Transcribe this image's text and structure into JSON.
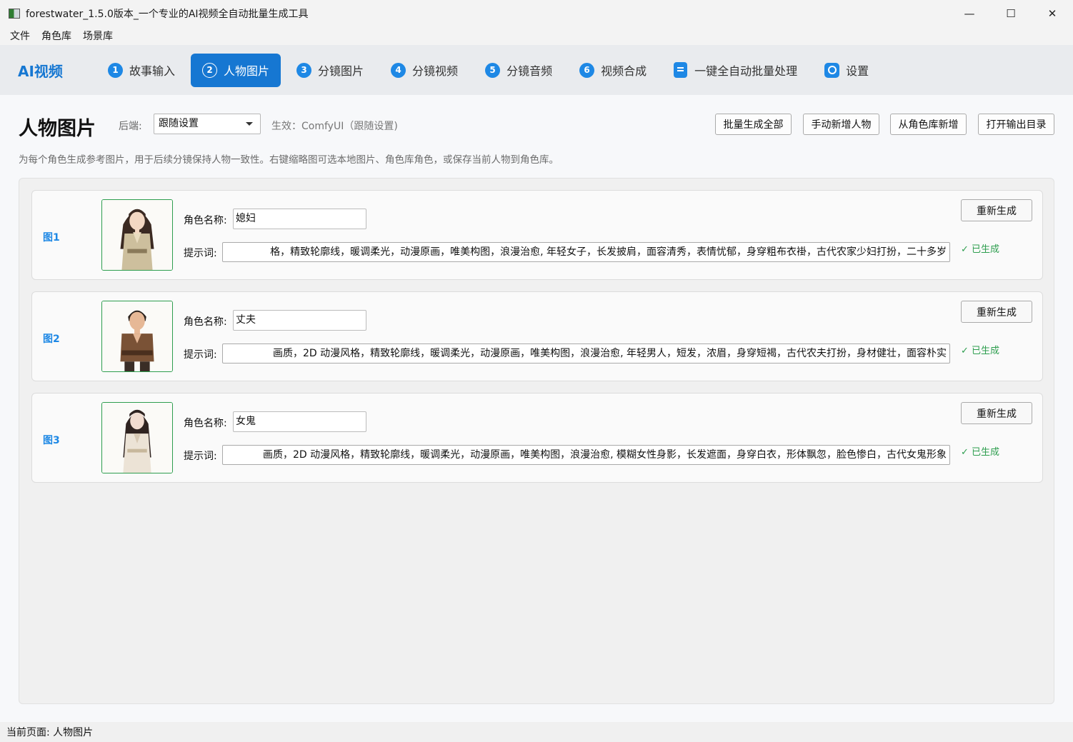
{
  "window": {
    "title": "forestwater_1.5.0版本_一个专业的AI视频全自动批量生成工具",
    "controls": {
      "minimize": "—",
      "maximize": "☐",
      "close": "✕"
    }
  },
  "menu": [
    "文件",
    "角色库",
    "场景库"
  ],
  "nav": {
    "brand": "AI视频",
    "tabs": [
      {
        "num": "1",
        "label": "故事输入",
        "icon": "number-badge"
      },
      {
        "num": "2",
        "label": "人物图片",
        "icon": "number-badge",
        "active": true
      },
      {
        "num": "3",
        "label": "分镜图片",
        "icon": "number-badge"
      },
      {
        "num": "4",
        "label": "分镜视频",
        "icon": "number-badge"
      },
      {
        "num": "5",
        "label": "分镜音频",
        "icon": "number-badge"
      },
      {
        "num": "6",
        "label": "视频合成",
        "icon": "number-badge"
      },
      {
        "num": "",
        "label": "一键全自动批量处理",
        "icon": "document-icon"
      },
      {
        "num": "",
        "label": "设置",
        "icon": "gear-icon"
      }
    ]
  },
  "page": {
    "title": "人物图片",
    "backend_label": "后端:",
    "backend_value": "跟随设置",
    "effective": "生效：ComfyUI（跟随设置)",
    "buttons": {
      "batch_all": "批量生成全部",
      "manual_add": "手动新增人物",
      "from_library": "从角色库新增",
      "open_output": "打开输出目录"
    },
    "description": "为每个角色生成参考图片，用于后续分镜保持人物一致性。右键缩略图可选本地图片、角色库角色，或保存当前人物到角色库。"
  },
  "characters": [
    {
      "label": "图1",
      "name_label": "角色名称:",
      "name": "媳妇",
      "prompt_label": "提示词:",
      "prompt": "格，精致轮廓线，暖调柔光，动漫原画，唯美构图，浪漫治愈, 年轻女子，长发披肩，面容清秀，表情忧郁，身穿粗布衣褂，古代农家少妇打扮，二十多岁",
      "regen": "重新生成",
      "status": "✓ 已生成"
    },
    {
      "label": "图2",
      "name_label": "角色名称:",
      "name": "丈夫",
      "prompt_label": "提示词:",
      "prompt": "画质，2D 动漫风格，精致轮廓线，暖调柔光，动漫原画，唯美构图，浪漫治愈, 年轻男人，短发，浓眉，身穿短褐，古代农夫打扮，身材健壮，面容朴实",
      "regen": "重新生成",
      "status": "✓ 已生成"
    },
    {
      "label": "图3",
      "name_label": "角色名称:",
      "name": "女鬼",
      "prompt_label": "提示词:",
      "prompt": "画质，2D 动漫风格，精致轮廓线，暖调柔光，动漫原画，唯美构图，浪漫治愈, 模糊女性身影，长发遮面，身穿白衣，形体飘忽，脸色惨白，古代女鬼形象",
      "regen": "重新生成",
      "status": "✓ 已生成"
    }
  ],
  "statusbar": "当前页面: 人物图片"
}
